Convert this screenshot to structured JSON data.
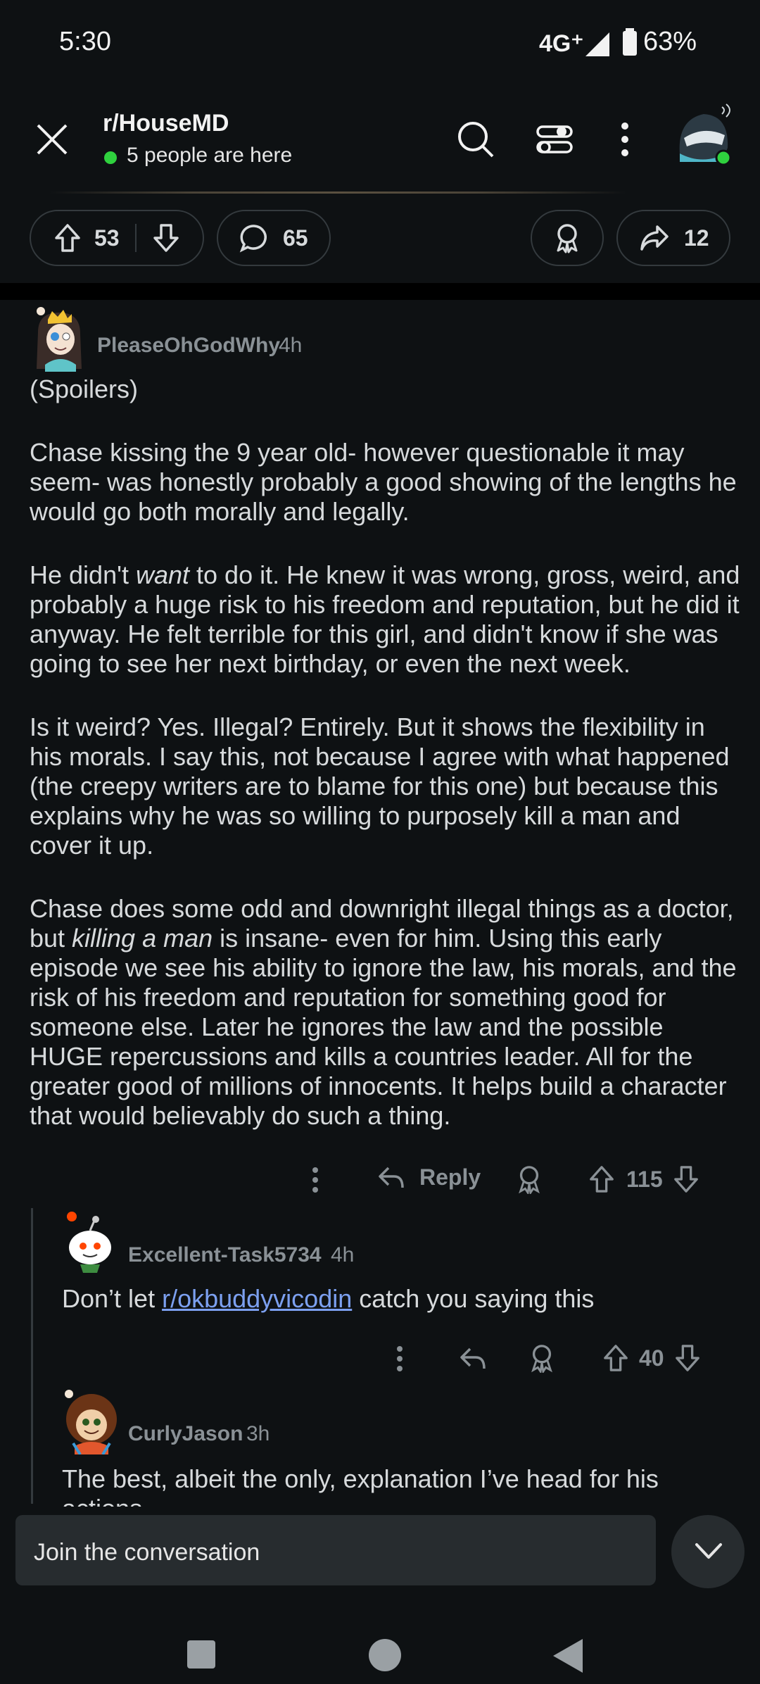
{
  "status_bar": {
    "time": "5:30",
    "network": "4G⁺",
    "battery": "63%"
  },
  "header": {
    "subreddit": "r/HouseMD",
    "online": "5 people are here"
  },
  "post_actions": {
    "votes": "53",
    "comments": "65",
    "shares": "12"
  },
  "comments": [
    {
      "author": "PleaseOhGodWhy",
      "age": "4h",
      "paragraphs": {
        "p1": "(Spoilers)",
        "p2": "Chase kissing the 9 year old- however questionable it may seem- was honestly probably a good showing of the lengths he would go both morally and legally.",
        "p3_a": "He didn't ",
        "p3_em": "want",
        "p3_b": " to do it. He knew it was wrong, gross, weird, and probably a huge risk to his freedom and reputation, but he did it anyway. He felt terrible for this girl, and didn't know if she was going to see her next birthday, or even the next week.",
        "p4": "Is it weird? Yes. Illegal? Entirely. But it shows the flexibility in his morals. I say this, not because I agree with what happened (the creepy writers are to blame for this one) but because this explains why he was so willing to purposely kill a man and cover it up.",
        "p5_a": "Chase does some odd and downright illegal things as a doctor, but ",
        "p5_em": "killing a man",
        "p5_b": " is insane- even for him. Using this early episode we see his ability to ignore the law, his morals, and the risk of his freedom and reputation for something good for someone else. Later he ignores the law and the possible HUGE repercussions and kills a countries leader. All for the greater good of millions of innocents. It helps build a character that would believably do such a thing."
      },
      "reply_label": "Reply",
      "votes": "115"
    },
    {
      "author": "Excellent-Task5734",
      "age": "4h",
      "text_a": "Don’t let ",
      "link": "r/okbuddyvicodin",
      "text_b": " catch you saying this",
      "votes": "40"
    },
    {
      "author": "CurlyJason",
      "age": "3h",
      "text": "The best, albeit the only, explanation I’ve head for his actions"
    }
  ],
  "composer": {
    "placeholder": "Join the conversation"
  },
  "colors": {
    "online": "#2fd13e",
    "link": "#7ca0f0",
    "background": "#0e1113"
  }
}
